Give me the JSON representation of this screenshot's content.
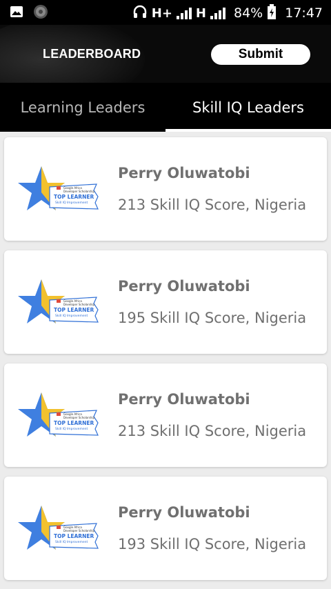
{
  "status_bar": {
    "network_1": "H+",
    "network_2": "H",
    "battery": "84%",
    "time": "17:47"
  },
  "header": {
    "title": "LEADERBOARD",
    "submit_label": "Submit"
  },
  "tabs": [
    {
      "label": "Learning Leaders",
      "active": false
    },
    {
      "label": "Skill IQ Leaders",
      "active": true
    }
  ],
  "badge": {
    "line1": "Google Africa",
    "line2": "Developer Scholarship",
    "title": "TOP LEARNER",
    "subtitle": "Skill IQ Improvement"
  },
  "leaders": [
    {
      "name": "Perry Oluwatobi",
      "details": "213 Skill IQ Score, Nigeria"
    },
    {
      "name": "Perry Oluwatobi",
      "details": "195 Skill IQ Score, Nigeria"
    },
    {
      "name": "Perry Oluwatobi",
      "details": "213 Skill IQ Score, Nigeria"
    },
    {
      "name": "Perry Oluwatobi",
      "details": "193 Skill IQ Score, Nigeria"
    }
  ],
  "colors": {
    "header_bg": "#000000",
    "card_bg": "#ffffff",
    "star_blue": "#3f7fe0",
    "star_yellow": "#f2c12e",
    "badge_text": "#2f6fd6"
  },
  "icons": [
    "image-icon",
    "settings-dial-icon",
    "headphones-icon",
    "signal-icon",
    "battery-charging-icon",
    "star-badge-icon"
  ]
}
